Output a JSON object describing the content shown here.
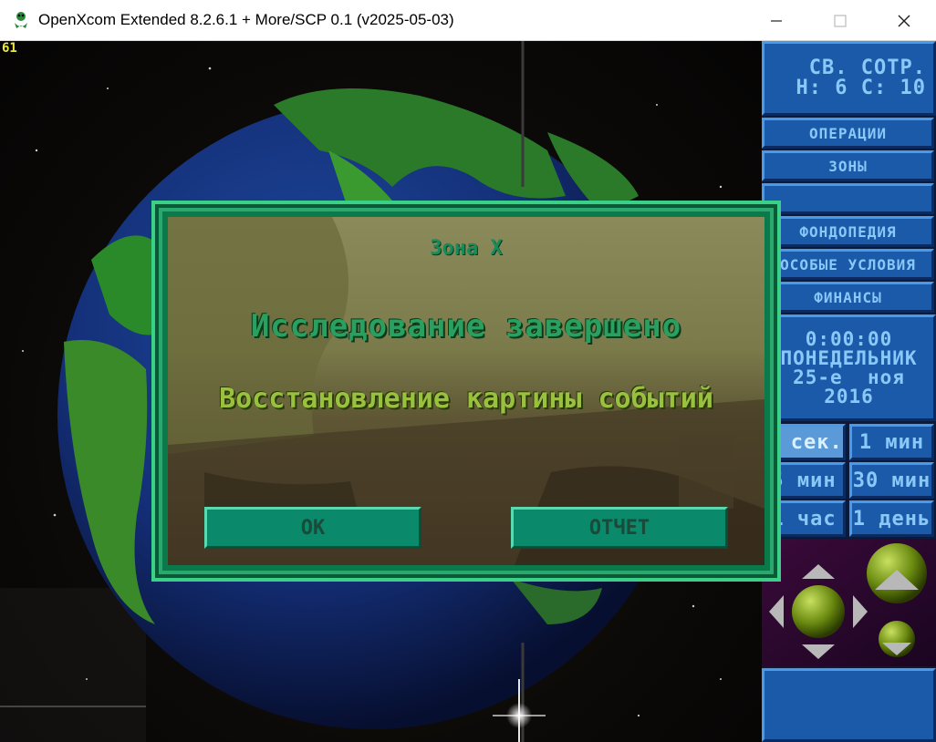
{
  "window": {
    "title": "OpenXcom Extended 8.2.6.1 + More/SCP 0.1 (v2025-05-03)",
    "minimize_icon": "minimize-icon",
    "maximize_icon": "maximize-icon",
    "close_icon": "close-icon"
  },
  "hud": {
    "fps": "61"
  },
  "panel": {
    "info_line1": "СВ. СОТР.",
    "info_line2": "Н: 6 С: 10",
    "buttons": [
      "ОПЕРАЦИИ",
      "ЗОНЫ",
      "",
      "ФОНДОПЕДИЯ",
      "ОСОБЫЕ УСЛОВИЯ",
      "ФИНАНСЫ"
    ],
    "clock": {
      "time": "0:00:00",
      "weekday": "ПОНЕДЕЛЬНИК",
      "day": "25-е",
      "month": "ноя",
      "year": "2016"
    },
    "speeds": [
      "5 сек.",
      "1 мин",
      "5 мин",
      "30 мин",
      "1 час",
      "1 день"
    ],
    "selected_speed": "5 сек."
  },
  "dialog": {
    "title": "Зона Х",
    "line1": "Исследование завершено",
    "line2": "Восстановление картины событий",
    "ok_label": "ОК",
    "report_label": "ОТЧЕТ"
  },
  "colors": {
    "panel_button": "#1a5aa8",
    "panel_text": "#8ac8f8",
    "dialog_border": "#0a7a4a",
    "dialog_button": "#0a8a6a"
  }
}
